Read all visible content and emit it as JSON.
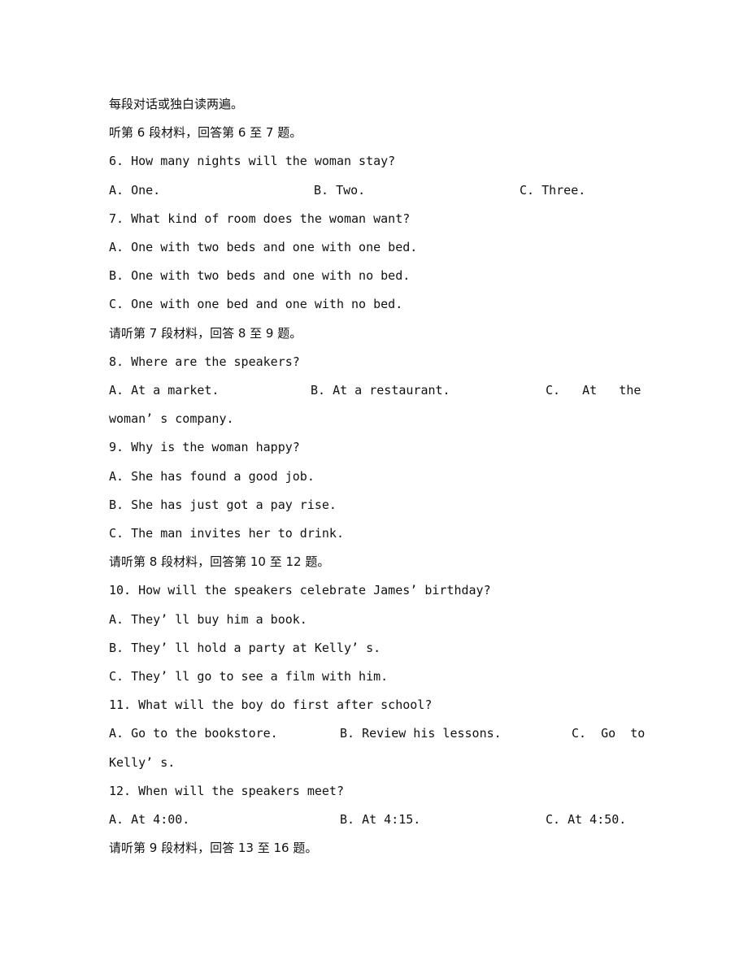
{
  "lines": [
    {
      "type": "instruction",
      "text": "每段对话或独白读两遍。"
    },
    {
      "type": "instruction",
      "text": "听第 6 段材料，回答第 6 至 7 题。"
    },
    {
      "type": "question",
      "text": "6. How many nights will the woman stay?"
    },
    {
      "type": "options",
      "a": "A. One.",
      "b": "B. Two.",
      "c": "C. Three."
    },
    {
      "type": "question",
      "text": "7. What kind of room does the woman want?"
    },
    {
      "type": "option",
      "text": "A. One with two beds and one with one bed."
    },
    {
      "type": "option",
      "text": "B. One with two beds and one with no bed."
    },
    {
      "type": "option",
      "text": "C. One with one bed and one with no bed."
    },
    {
      "type": "instruction",
      "text": "请听第 7 段材料，回答 8 至 9 题。"
    },
    {
      "type": "question",
      "text": "8. Where are the speakers?"
    },
    {
      "type": "options",
      "a": "A. At a market.",
      "b": "B. At a restaurant.",
      "c": "C.   At   the"
    },
    {
      "type": "option",
      "text": "woman’ s company."
    },
    {
      "type": "question",
      "text": "9. Why is the woman happy?"
    },
    {
      "type": "option",
      "text": "A. She has found a good job."
    },
    {
      "type": "option",
      "text": "B. She has just got a pay rise."
    },
    {
      "type": "option",
      "text": "C. The man invites her to drink."
    },
    {
      "type": "instruction",
      "text": "请听第 8 段材料，回答第 10 至 12 题。"
    },
    {
      "type": "question",
      "text": "10. How will the speakers celebrate James’ birthday?"
    },
    {
      "type": "option",
      "text": "A. They’ ll buy him a book."
    },
    {
      "type": "option",
      "text": "B. They’ ll hold a party at Kelly’ s."
    },
    {
      "type": "option",
      "text": "C. They’ ll go to see a film with him."
    },
    {
      "type": "question",
      "text": "11. What will the boy do first after school?"
    },
    {
      "type": "options",
      "a": "A. Go to the bookstore.",
      "b": "B. Review his lessons.",
      "c": "C.  Go  to"
    },
    {
      "type": "option",
      "text": "Kelly’ s."
    },
    {
      "type": "question",
      "text": "12. When will the speakers meet?"
    },
    {
      "type": "options",
      "a": "A. At 4:00.",
      "b": "B. At 4:15.",
      "c": "C. At 4:50."
    },
    {
      "type": "instruction",
      "text": "请听第 9 段材料，回答 13 至 16 题。"
    }
  ]
}
